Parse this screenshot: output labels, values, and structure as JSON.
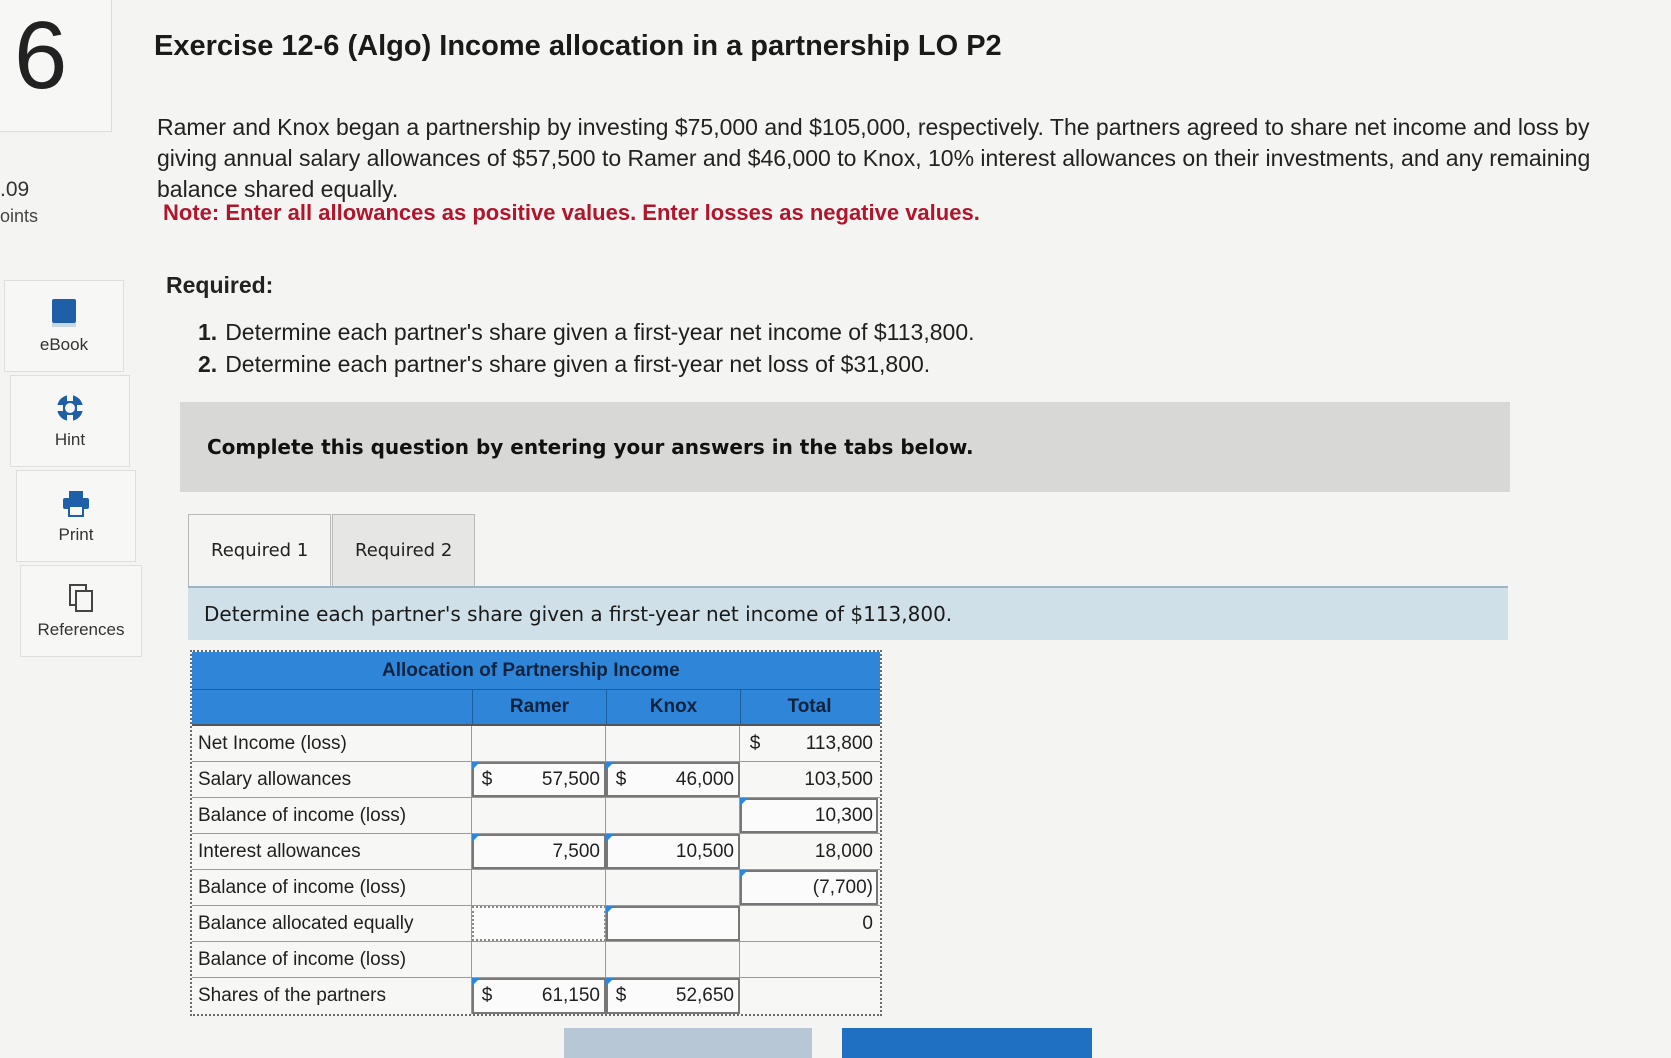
{
  "question": {
    "number": "6",
    "points_value": ".09",
    "points_label": "oints"
  },
  "tools": [
    {
      "label": "eBook",
      "icon": "book-icon"
    },
    {
      "label": "Hint",
      "icon": "lifebuoy-icon"
    },
    {
      "label": "Print",
      "icon": "printer-icon"
    },
    {
      "label": "References",
      "icon": "documents-icon"
    }
  ],
  "title": "Exercise 12-6 (Algo) Income allocation in a partnership LO P2",
  "prompt": "Ramer and Knox began a partnership by investing $75,000 and $105,000, respectively. The partners agreed to share net income and loss by giving annual salary allowances of $57,500 to Ramer and $46,000 to Knox, 10% interest allowances on their investments, and any remaining balance shared equally.",
  "note": "Note: Enter all allowances as positive values. Enter losses as negative values.",
  "required_heading": "Required:",
  "requirements": [
    {
      "num": "1.",
      "text": "Determine each partner's share given a first-year net income of $113,800."
    },
    {
      "num": "2.",
      "text": "Determine each partner's share given a first-year net loss of $31,800."
    }
  ],
  "instruction": "Complete this question by entering your answers in the tabs below.",
  "tabs": [
    {
      "label": "Required 1"
    },
    {
      "label": "Required 2"
    }
  ],
  "subheading": "Determine each partner's share given a first-year net income of $113,800.",
  "table": {
    "title": "Allocation of Partnership Income",
    "columns": {
      "ramer": "Ramer",
      "knox": "Knox",
      "total": "Total"
    },
    "rows": {
      "net_income": {
        "label": "Net Income (loss)",
        "total_dollar": "$",
        "total": "113,800"
      },
      "salary": {
        "label": "Salary allowances",
        "ramer_dollar": "$",
        "ramer": "57,500",
        "knox_dollar": "$",
        "knox": "46,000",
        "total": "103,500"
      },
      "balance1": {
        "label": "Balance of income (loss)",
        "total": "10,300"
      },
      "interest": {
        "label": "Interest allowances",
        "ramer": "7,500",
        "knox": "10,500",
        "total": "18,000"
      },
      "balance2": {
        "label": "Balance of income (loss)",
        "total": "(7,700)"
      },
      "allocated": {
        "label": "Balance allocated equally",
        "ramer": "",
        "knox": "",
        "total": "0"
      },
      "balance3": {
        "label": "Balance of income (loss)"
      },
      "shares": {
        "label": "Shares of the partners",
        "ramer_dollar": "$",
        "ramer": "61,150",
        "knox_dollar": "$",
        "knox": "52,650"
      }
    }
  }
}
